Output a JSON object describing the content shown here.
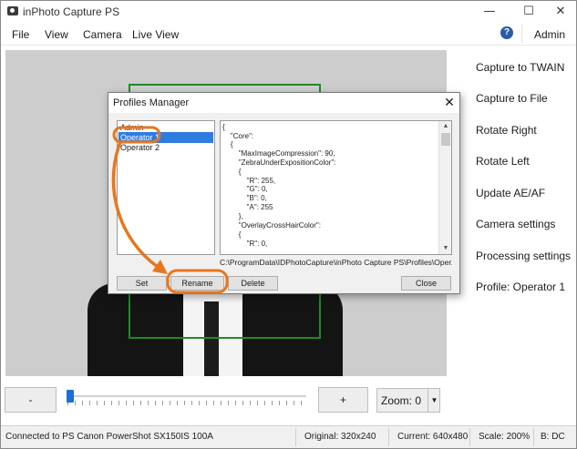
{
  "window": {
    "title": "inPhoto Capture PS",
    "minimize_glyph": "—",
    "maximize_glyph": "☐",
    "close_glyph": "✕"
  },
  "menu": {
    "items": [
      "File",
      "View",
      "Camera",
      "Live View"
    ],
    "help_glyph": "?",
    "user": "Admin"
  },
  "side_panel": {
    "items": [
      "Capture to TWAIN",
      "Capture to File",
      "Rotate Right",
      "Rotate Left",
      "Update AE/AF",
      "Camera settings",
      "Processing settings",
      "Profile: Operator 1"
    ]
  },
  "controls": {
    "zoom_out_label": "-",
    "zoom_in_label": "+",
    "zoom_label": "Zoom: 0",
    "zoom_arrow": "▼",
    "slider_level": 0
  },
  "status_bar": {
    "connection": "Connected to PS Canon PowerShot SX150IS 100A",
    "original": "Original: 320x240",
    "current": "Current: 640x480",
    "scale": "Scale: 200%",
    "b": "B: DC"
  },
  "dialog": {
    "title": "Profiles Manager",
    "close_glyph": "✕",
    "profiles": [
      {
        "name": "Admin",
        "selected": false
      },
      {
        "name": "Operator 1",
        "selected": true
      },
      {
        "name": "Operator 2",
        "selected": false
      }
    ],
    "json_lines": [
      "{",
      "    \"Core\":",
      "    {",
      "        \"MaxImageCompression\": 90,",
      "        \"ZebraUnderExpositionColor\":",
      "        {",
      "            \"R\": 255,",
      "            \"G\": 0,",
      "            \"B\": 0,",
      "            \"A\": 255",
      "        },",
      "        \"OverlayCrossHairColor\":",
      "        {",
      "            \"R\": 0,"
    ],
    "path": "C:\\ProgramData\\IDPhotoCapture\\inPhoto Capture PS\\Profiles\\Oper...",
    "buttons": {
      "set": "Set",
      "rename": "Rename",
      "delete": "Delete",
      "close": "Close"
    }
  },
  "colors": {
    "accent_orange": "#e8761e",
    "selection_blue": "#2f7ce0",
    "frame_green": "#1f8a2a"
  }
}
